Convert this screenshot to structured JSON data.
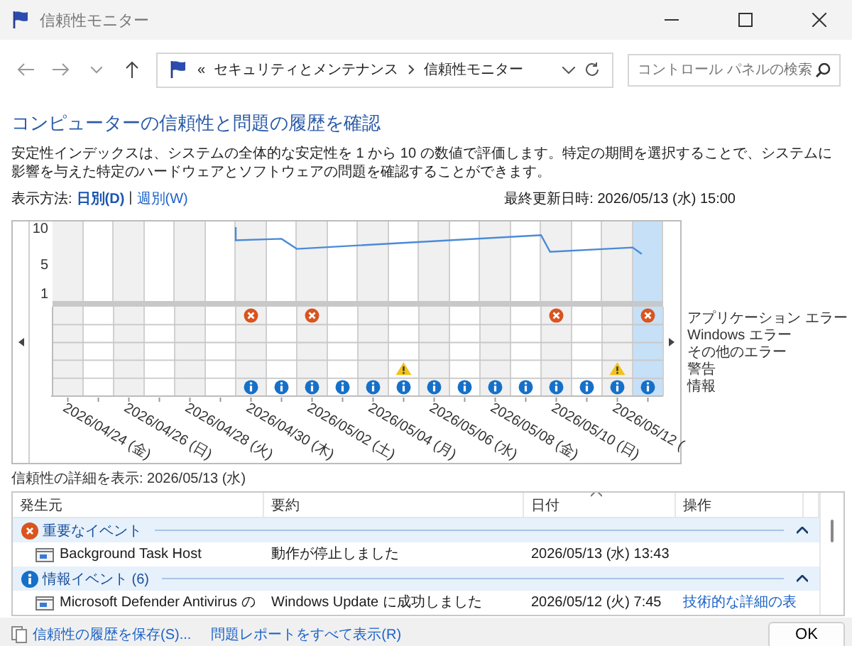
{
  "window": {
    "title": "信頼性モニター"
  },
  "address": {
    "overflow": "«",
    "breadcrumb": [
      "セキュリティとメンテナンス",
      "信頼性モニター"
    ]
  },
  "search": {
    "placeholder": "コントロール パネルの検索"
  },
  "heading": "コンピューターの信頼性と問題の履歴を確認",
  "description": "安定性インデックスは、システムの全体的な安定性を 1 から 10 の数値で評価します。特定の期間を選択することで、システムに影響を与えた特定のハードウェアとソフトウェアの問題を確認することができます。",
  "view": {
    "label": "表示方法:",
    "separator": "|",
    "options": [
      {
        "label": "日別(D)",
        "selected": true
      },
      {
        "label": "週別(W)",
        "selected": false
      }
    ],
    "last_updated": "最終更新日時: 2026/05/13 (水) 15:00"
  },
  "chart": {
    "y_labels": [
      "10",
      "5",
      "1"
    ],
    "date_labels": [
      "2026/04/24 (金)",
      "2026/04/26 (日)",
      "2026/04/28 (火)",
      "2026/04/30 (木)",
      "2026/05/02 (土)",
      "2026/05/04 (月)",
      "2026/05/06 (水)",
      "2026/05/08 (金)",
      "2026/05/10 (日)",
      "2026/05/12 ("
    ],
    "days": [
      {
        "selected": false,
        "app_error": false,
        "warning": false,
        "info": false
      },
      {
        "selected": false,
        "app_error": false,
        "warning": false,
        "info": false
      },
      {
        "selected": false,
        "app_error": false,
        "warning": false,
        "info": false
      },
      {
        "selected": false,
        "app_error": false,
        "warning": false,
        "info": false
      },
      {
        "selected": false,
        "app_error": false,
        "warning": false,
        "info": false
      },
      {
        "selected": false,
        "app_error": false,
        "warning": false,
        "info": false
      },
      {
        "selected": false,
        "app_error": true,
        "warning": false,
        "info": true
      },
      {
        "selected": false,
        "app_error": false,
        "warning": false,
        "info": true
      },
      {
        "selected": false,
        "app_error": true,
        "warning": false,
        "info": true
      },
      {
        "selected": false,
        "app_error": false,
        "warning": false,
        "info": true
      },
      {
        "selected": false,
        "app_error": false,
        "warning": false,
        "info": true
      },
      {
        "selected": false,
        "app_error": false,
        "warning": true,
        "info": true
      },
      {
        "selected": false,
        "app_error": false,
        "warning": false,
        "info": true
      },
      {
        "selected": false,
        "app_error": false,
        "warning": false,
        "info": true
      },
      {
        "selected": false,
        "app_error": false,
        "warning": false,
        "info": true
      },
      {
        "selected": false,
        "app_error": false,
        "warning": false,
        "info": true
      },
      {
        "selected": false,
        "app_error": true,
        "warning": false,
        "info": true
      },
      {
        "selected": false,
        "app_error": false,
        "warning": false,
        "info": true
      },
      {
        "selected": false,
        "app_error": false,
        "warning": true,
        "info": true
      },
      {
        "selected": true,
        "app_error": true,
        "warning": false,
        "info": true
      }
    ],
    "legend": [
      "アプリケーション エラー",
      "Windows エラー",
      "その他のエラー",
      "警告",
      "情報"
    ]
  },
  "details": {
    "title": "信頼性の詳細を表示: 2026/05/13 (水)",
    "columns": [
      {
        "label": "発生元",
        "sorted": false
      },
      {
        "label": "要約",
        "sorted": false
      },
      {
        "label": "日付",
        "sorted": true
      },
      {
        "label": "操作",
        "sorted": false
      }
    ],
    "groups": [
      {
        "kind": "critical",
        "title": "重要なイベント",
        "expanded": true,
        "rows": [
          {
            "source": "Background Task Host",
            "summary": "動作が停止しました",
            "date": "2026/05/13 (水) 13:43"
          }
        ]
      },
      {
        "kind": "info",
        "title": "情報イベント (6)",
        "expanded": true,
        "rows": [
          {
            "source": "Microsoft Defender Antivirus の",
            "summary": "Windows Update に成功しました",
            "date": "2026/05/12 (火) 7:45",
            "action": "技術的な詳細の表"
          }
        ]
      }
    ]
  },
  "footer": {
    "links": [
      "信頼性の履歴を保存(S)...",
      "問題レポートをすべて表示(R)"
    ],
    "ok": "OK"
  }
}
